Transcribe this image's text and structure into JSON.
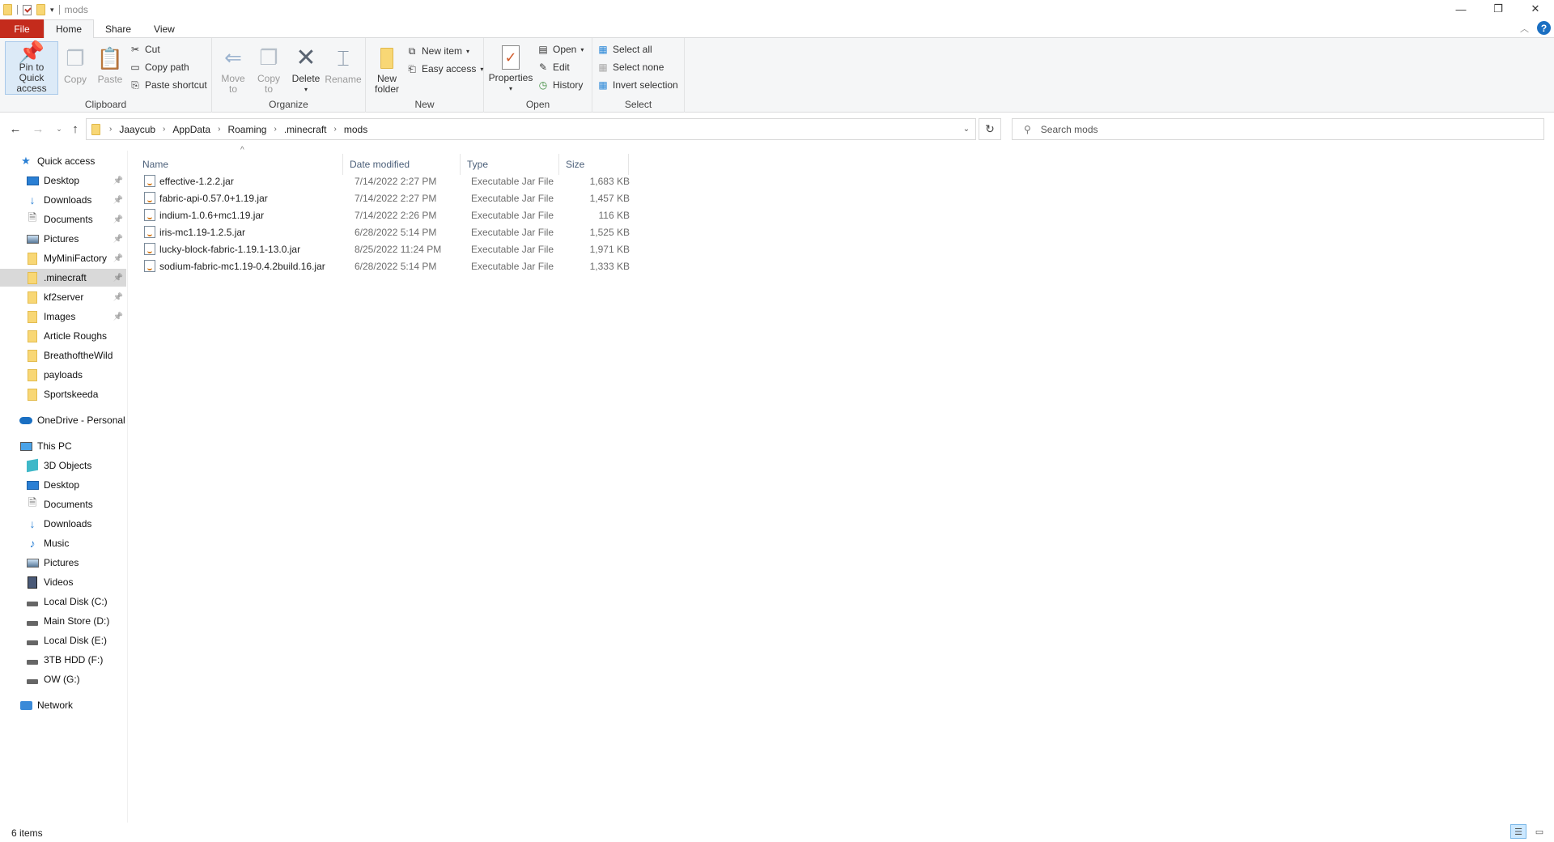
{
  "window": {
    "title": "mods",
    "controls": {
      "minimize": "—",
      "restore": "❐",
      "close": "✕"
    }
  },
  "tabs": [
    {
      "label": "File"
    },
    {
      "label": "Home",
      "active": true
    },
    {
      "label": "Share"
    },
    {
      "label": "View"
    }
  ],
  "ribbon": {
    "clipboard": {
      "label": "Clipboard",
      "pin_to_quick_access": "Pin to Quick access",
      "pin_line1": "Pin to Quick",
      "pin_line2": "access",
      "copy": "Copy",
      "paste": "Paste",
      "cut": "Cut",
      "copy_path": "Copy path",
      "paste_shortcut": "Paste shortcut"
    },
    "organize": {
      "label": "Organize",
      "move_to_1": "Move",
      "move_to_2": "to",
      "copy_to_1": "Copy",
      "copy_to_2": "to",
      "delete": "Delete",
      "rename": "Rename"
    },
    "new": {
      "label": "New",
      "new_folder_1": "New",
      "new_folder_2": "folder",
      "new_item": "New item",
      "easy_access": "Easy access"
    },
    "open": {
      "label": "Open",
      "properties": "Properties",
      "open": "Open",
      "edit": "Edit",
      "history": "History"
    },
    "select": {
      "label": "Select",
      "select_all": "Select all",
      "select_none": "Select none",
      "invert_selection": "Invert selection"
    }
  },
  "address": {
    "breadcrumbs": [
      "Jaaycub",
      "AppData",
      "Roaming",
      ".minecraft",
      "mods"
    ]
  },
  "search": {
    "placeholder": "Search mods"
  },
  "sidebar": {
    "quick_access": {
      "label": "Quick access",
      "items": [
        {
          "label": "Desktop",
          "icon": "desktop-icon",
          "pinned": true
        },
        {
          "label": "Downloads",
          "icon": "downloads-icon",
          "pinned": true
        },
        {
          "label": "Documents",
          "icon": "documents-icon",
          "pinned": true
        },
        {
          "label": "Pictures",
          "icon": "pictures-icon",
          "pinned": true
        },
        {
          "label": "MyMiniFactory",
          "icon": "folder-icon",
          "pinned": true
        },
        {
          "label": ".minecraft",
          "icon": "folder-icon",
          "pinned": true,
          "selected": true
        },
        {
          "label": "kf2server",
          "icon": "folder-icon",
          "pinned": true
        },
        {
          "label": "Images",
          "icon": "folder-icon",
          "pinned": true
        },
        {
          "label": "Article Roughs",
          "icon": "folder-icon",
          "pinned": false
        },
        {
          "label": "BreathoftheWild",
          "icon": "folder-icon",
          "pinned": false
        },
        {
          "label": "payloads",
          "icon": "folder-icon",
          "pinned": false
        },
        {
          "label": "Sportskeeda",
          "icon": "folder-icon",
          "pinned": false
        }
      ]
    },
    "onedrive": {
      "label": "OneDrive - Personal"
    },
    "this_pc": {
      "label": "This PC",
      "items": [
        {
          "label": "3D Objects",
          "icon": "3d-objects-icon"
        },
        {
          "label": "Desktop",
          "icon": "desktop-icon"
        },
        {
          "label": "Documents",
          "icon": "documents-icon"
        },
        {
          "label": "Downloads",
          "icon": "downloads-icon"
        },
        {
          "label": "Music",
          "icon": "music-icon"
        },
        {
          "label": "Pictures",
          "icon": "pictures-icon"
        },
        {
          "label": "Videos",
          "icon": "videos-icon"
        },
        {
          "label": "Local Disk (C:)",
          "icon": "drive-icon"
        },
        {
          "label": "Main Store (D:)",
          "icon": "drive-icon"
        },
        {
          "label": "Local Disk (E:)",
          "icon": "drive-icon"
        },
        {
          "label": "3TB HDD (F:)",
          "icon": "drive-icon"
        },
        {
          "label": "OW (G:)",
          "icon": "drive-icon"
        }
      ]
    },
    "network": {
      "label": "Network"
    }
  },
  "file_list": {
    "columns": {
      "name": "Name",
      "date": "Date modified",
      "type": "Type",
      "size": "Size"
    },
    "sort": {
      "column": "Name",
      "direction": "ascending"
    },
    "files": [
      {
        "name": "effective-1.2.2.jar",
        "date": "7/14/2022 2:27 PM",
        "type": "Executable Jar File",
        "size": "1,683 KB"
      },
      {
        "name": "fabric-api-0.57.0+1.19.jar",
        "date": "7/14/2022 2:27 PM",
        "type": "Executable Jar File",
        "size": "1,457 KB"
      },
      {
        "name": "indium-1.0.6+mc1.19.jar",
        "date": "7/14/2022 2:26 PM",
        "type": "Executable Jar File",
        "size": "116 KB"
      },
      {
        "name": "iris-mc1.19-1.2.5.jar",
        "date": "6/28/2022 5:14 PM",
        "type": "Executable Jar File",
        "size": "1,525 KB"
      },
      {
        "name": "lucky-block-fabric-1.19.1-13.0.jar",
        "date": "8/25/2022 11:24 PM",
        "type": "Executable Jar File",
        "size": "1,971 KB"
      },
      {
        "name": "sodium-fabric-mc1.19-0.4.2build.16.jar",
        "date": "6/28/2022 5:14 PM",
        "type": "Executable Jar File",
        "size": "1,333 KB"
      }
    ]
  },
  "status": {
    "item_count": "6 items",
    "view": "details"
  }
}
